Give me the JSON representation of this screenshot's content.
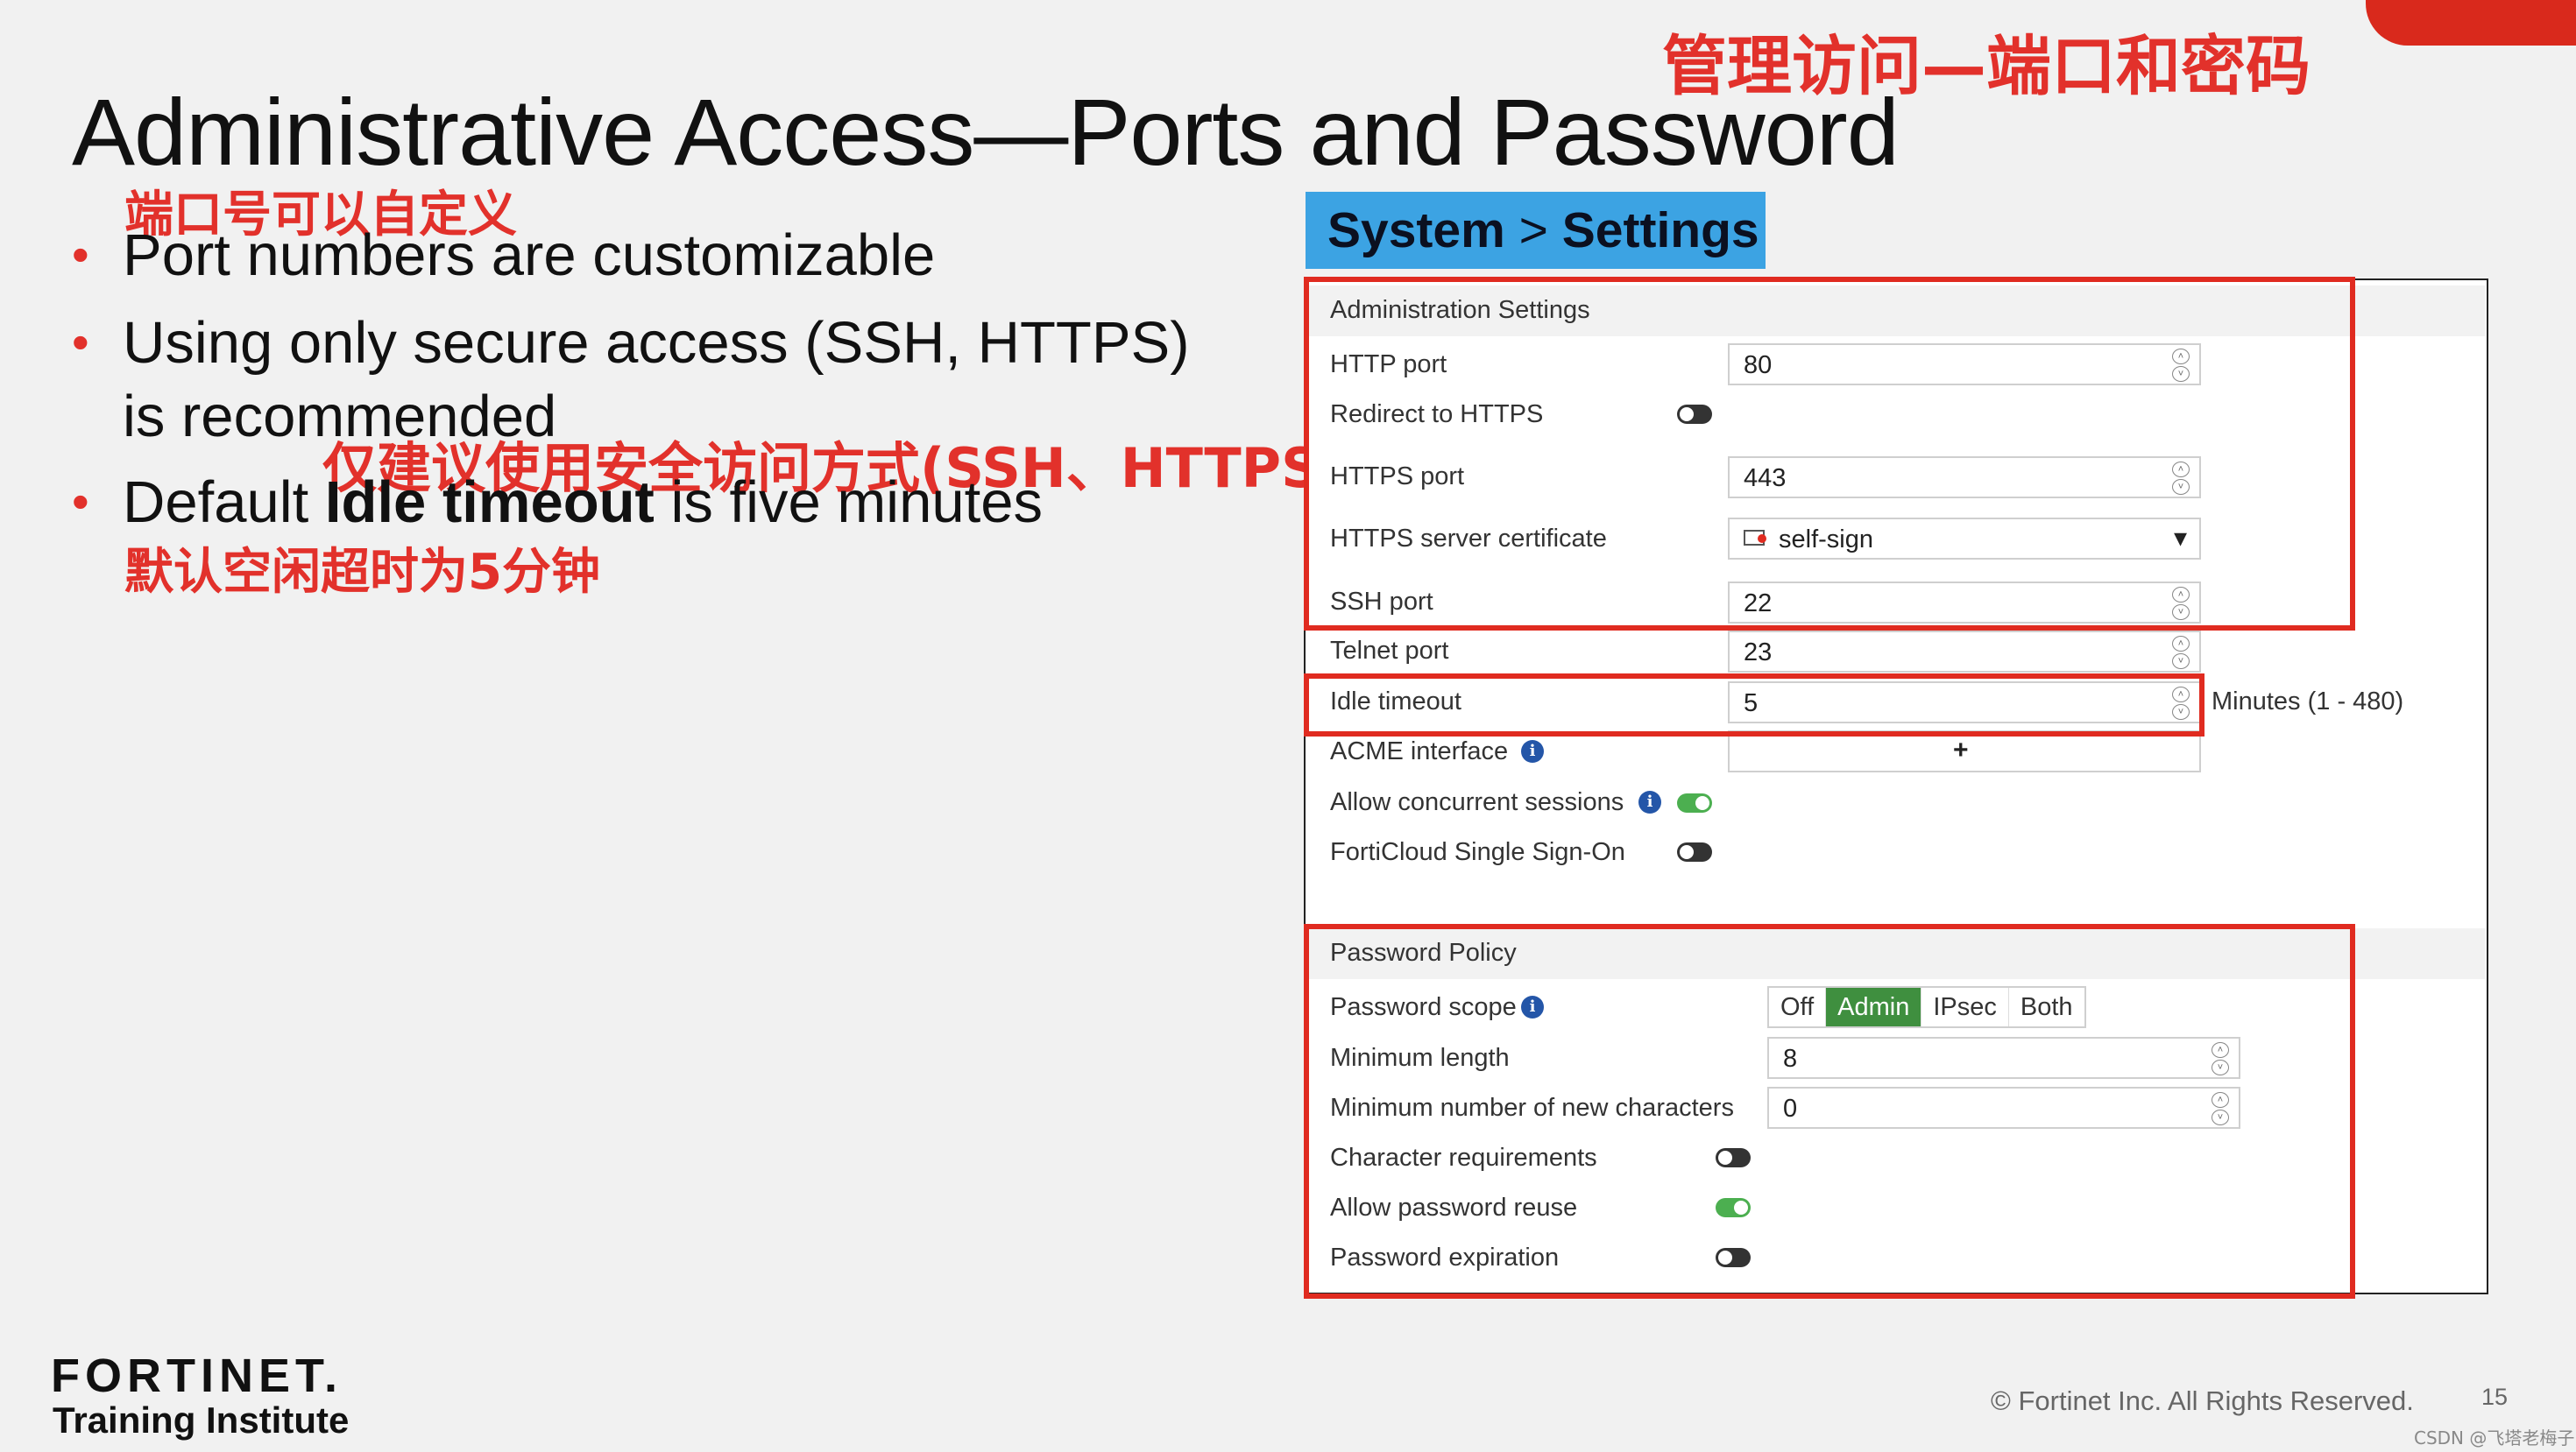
{
  "slide": {
    "title": "Administrative Access—Ports and Password",
    "title_cn": "管理访问—端口和密码",
    "bullets": [
      {
        "text": "Port numbers are customizable",
        "annotation_cn": "端口号可以自定义"
      },
      {
        "text_line1": "Using only secure access (SSH, HTTPS)",
        "text_line2": "is recommended",
        "annotation_cn": "仅建议使用安全访问方式(SSH、HTTPS)"
      },
      {
        "text_pre": "Default ",
        "text_bold": "Idle timeout",
        "text_post": " is five minutes",
        "annotation_cn": "默认空闲超时为5分钟"
      }
    ],
    "bullet_symbol": "•"
  },
  "screenshot": {
    "header": {
      "system": "System",
      "separator": ">",
      "settings": "Settings"
    },
    "admin_section": {
      "title": "Administration Settings",
      "http_port": {
        "label": "HTTP port",
        "value": "80"
      },
      "redirect_https": {
        "label": "Redirect to HTTPS",
        "enabled": false
      },
      "https_port": {
        "label": "HTTPS port",
        "value": "443"
      },
      "https_cert": {
        "label": "HTTPS server certificate",
        "value": "self-sign"
      },
      "ssh_port": {
        "label": "SSH port",
        "value": "22"
      },
      "telnet_port": {
        "label": "Telnet port",
        "value": "23"
      },
      "idle_timeout": {
        "label": "Idle timeout",
        "value": "5",
        "unit": "Minutes (1 - 480)"
      },
      "acme_interface": {
        "label": "ACME interface",
        "add": "+"
      },
      "concurrent_sessions": {
        "label": "Allow concurrent sessions",
        "enabled": true
      },
      "forticloud_sso": {
        "label": "FortiCloud Single Sign-On",
        "enabled": false
      }
    },
    "password_section": {
      "title": "Password Policy",
      "scope": {
        "label": "Password scope",
        "options": [
          "Off",
          "Admin",
          "IPsec",
          "Both"
        ],
        "selected": "Admin"
      },
      "min_length": {
        "label": "Minimum length",
        "value": "8"
      },
      "min_new_chars": {
        "label": "Minimum number of new characters",
        "value": "0"
      },
      "char_requirements": {
        "label": "Character requirements",
        "enabled": false
      },
      "allow_reuse": {
        "label": "Allow password reuse",
        "enabled": true
      },
      "expiration": {
        "label": "Password expiration",
        "enabled": false
      }
    },
    "icons": {
      "info": "i",
      "spin_up": "˄",
      "spin_down": "˅",
      "dropdown": "▾",
      "cert_icon": "certificate-icon"
    }
  },
  "footer": {
    "logo_word": "FORTINET.",
    "logo_sub": "Training Institute",
    "copyright": "© Fortinet Inc. All Rights Reserved.",
    "page": "15",
    "watermark": "CSDN @飞塔老梅子"
  },
  "colors": {
    "accent": "#e02b20",
    "header_blue": "#3ca3e3",
    "toggle_on": "#4caf50",
    "segment_active": "#3f8f3f"
  }
}
